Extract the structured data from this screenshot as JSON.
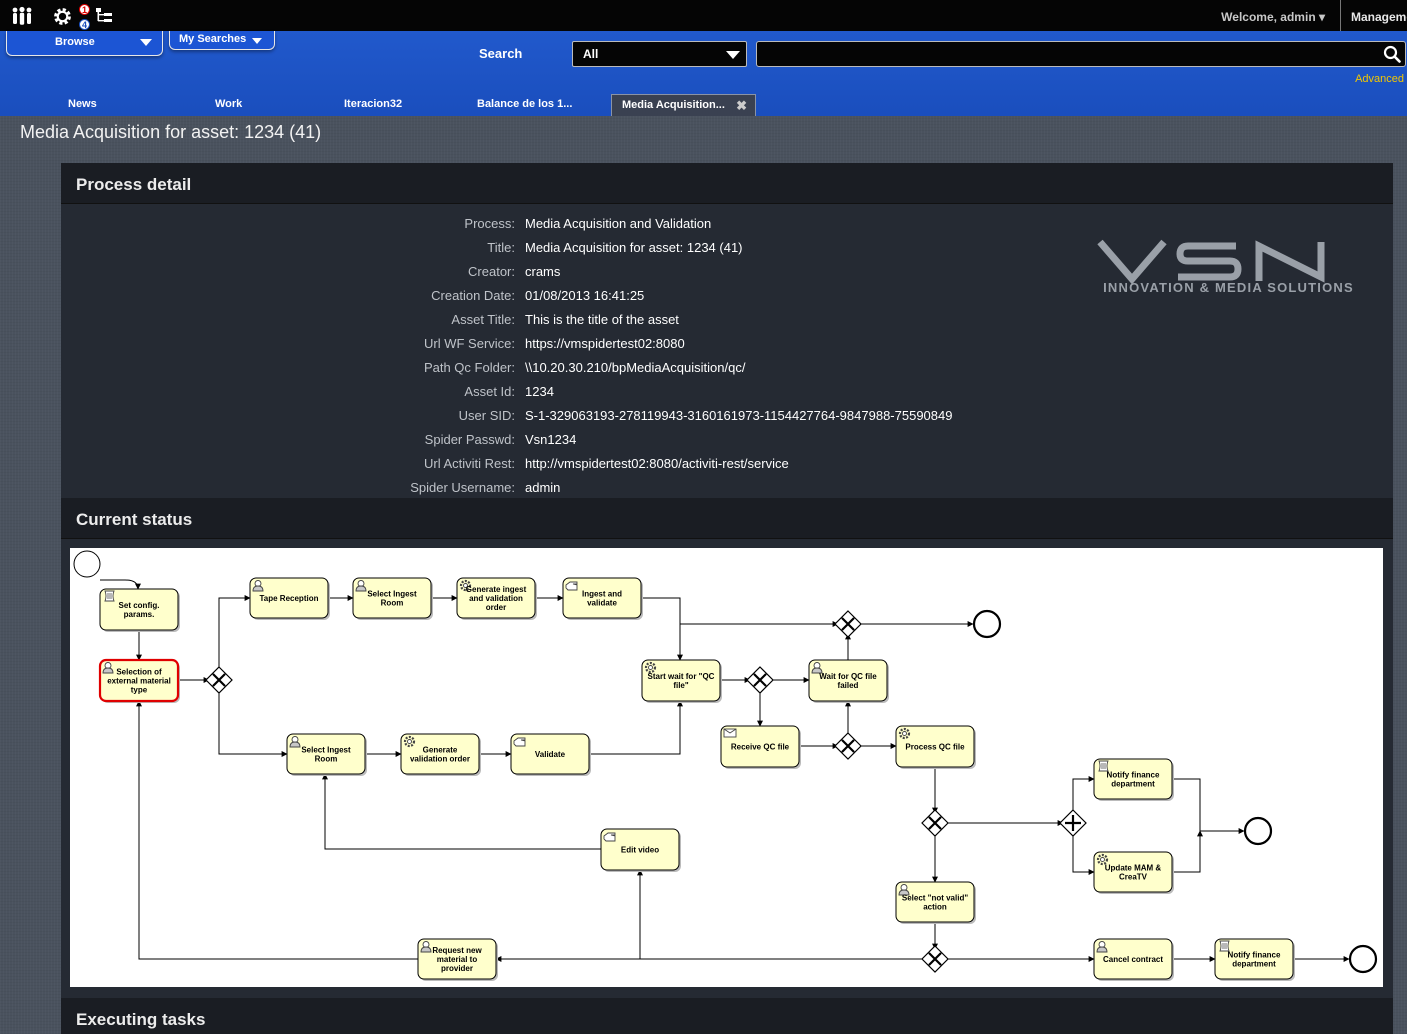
{
  "topbar": {
    "icons": [
      "users-icon",
      "gear-icon",
      "sitemap-icon"
    ],
    "badge_red": "1",
    "badge_blue": "4",
    "welcome": "Welcome, admin ▾",
    "management": "Management"
  },
  "header": {
    "browse": "Browse",
    "my_searches": "My Searches",
    "search_label": "Search",
    "search_scope": "All",
    "search_value": "",
    "advanced": "Advanced",
    "tabs": [
      {
        "label": "News"
      },
      {
        "label": "Work"
      },
      {
        "label": "Iteracion32"
      },
      {
        "label": "Balance de los 1..."
      },
      {
        "label": "Media Acquisition..."
      }
    ]
  },
  "page_title": "Media Acquisition for asset: 1234 (41)",
  "process_detail": {
    "heading": "Process detail",
    "rows": [
      {
        "key": "Process:",
        "value": "Media Acquisition and Validation"
      },
      {
        "key": "Title:",
        "value": "Media Acquisition for asset: 1234 (41)"
      },
      {
        "key": "Creator:",
        "value": "crams"
      },
      {
        "key": "Creation Date:",
        "value": "01/08/2013 16:41:25"
      },
      {
        "key": "Asset Title:",
        "value": "This is the title of the asset"
      },
      {
        "key": "Url WF Service:",
        "value": "https://vmspidertest02:8080"
      },
      {
        "key": "Path Qc Folder:",
        "value": "\\\\10.20.30.210/bpMediaAcquisition/qc/"
      },
      {
        "key": "Asset Id:",
        "value": "1234"
      },
      {
        "key": "User SID:",
        "value": "S-1-329063193-278119943-3160161973-1154427764-9847988-75590849"
      },
      {
        "key": "Spider Passwd:",
        "value": "Vsn1234"
      },
      {
        "key": "Url Activiti Rest:",
        "value": "http://vmspidertest02:8080/activiti-rest/service"
      },
      {
        "key": "Spider Username:",
        "value": "admin"
      }
    ],
    "logo_text": "VSN",
    "logo_sub": "INNOVATION & MEDIA SOLUTIONS"
  },
  "current_status": {
    "heading": "Current status",
    "tasks": [
      {
        "id": "t1",
        "lines": [
          "Set config.",
          "params."
        ],
        "icon": "script"
      },
      {
        "id": "t2",
        "lines": [
          "Selection of",
          "external material",
          "type"
        ],
        "icon": "user"
      },
      {
        "id": "t3",
        "lines": [
          "Tape Reception"
        ],
        "icon": "user"
      },
      {
        "id": "t4",
        "lines": [
          "Select Ingest",
          "Room"
        ],
        "icon": "user"
      },
      {
        "id": "t5",
        "lines": [
          "Generate ingest",
          "and validation",
          "order"
        ],
        "icon": "gear"
      },
      {
        "id": "t6",
        "lines": [
          "Ingest and",
          "validate"
        ],
        "icon": "hand"
      },
      {
        "id": "t7",
        "lines": [
          "Start wait for \"QC",
          "file\""
        ],
        "icon": "gear"
      },
      {
        "id": "t8",
        "lines": [
          "Wait for QC file",
          "failed"
        ],
        "icon": "user"
      },
      {
        "id": "t9",
        "lines": [
          "Receive QC file"
        ],
        "icon": "message"
      },
      {
        "id": "t10",
        "lines": [
          "Process QC file"
        ],
        "icon": "gear"
      },
      {
        "id": "t11",
        "lines": [
          "Select Ingest",
          "Room"
        ],
        "icon": "user"
      },
      {
        "id": "t12",
        "lines": [
          "Generate",
          "validation order"
        ],
        "icon": "gear"
      },
      {
        "id": "t13",
        "lines": [
          "Validate"
        ],
        "icon": "hand"
      },
      {
        "id": "t14",
        "lines": [
          "Edit video"
        ],
        "icon": "hand"
      },
      {
        "id": "t15",
        "lines": [
          "Notify finance",
          "department"
        ],
        "icon": "script"
      },
      {
        "id": "t16",
        "lines": [
          "Update MAM &",
          "CreaTV"
        ],
        "icon": "gear"
      },
      {
        "id": "t17",
        "lines": [
          "Select \"not valid\"",
          "action"
        ],
        "icon": "user"
      },
      {
        "id": "t18",
        "lines": [
          "Request new",
          "material to",
          "provider"
        ],
        "icon": "user"
      },
      {
        "id": "t19",
        "lines": [
          "Cancel contract"
        ],
        "icon": "user"
      },
      {
        "id": "t20",
        "lines": [
          "Notify finance",
          "department"
        ],
        "icon": "script"
      }
    ],
    "active_task": "t2"
  },
  "executing_tasks": {
    "heading": "Executing tasks"
  },
  "colors": {
    "task_fill": "#ffffcc",
    "active_border": "#e00000",
    "header_blue": "#1f55c8",
    "advanced": "#f3c700"
  }
}
